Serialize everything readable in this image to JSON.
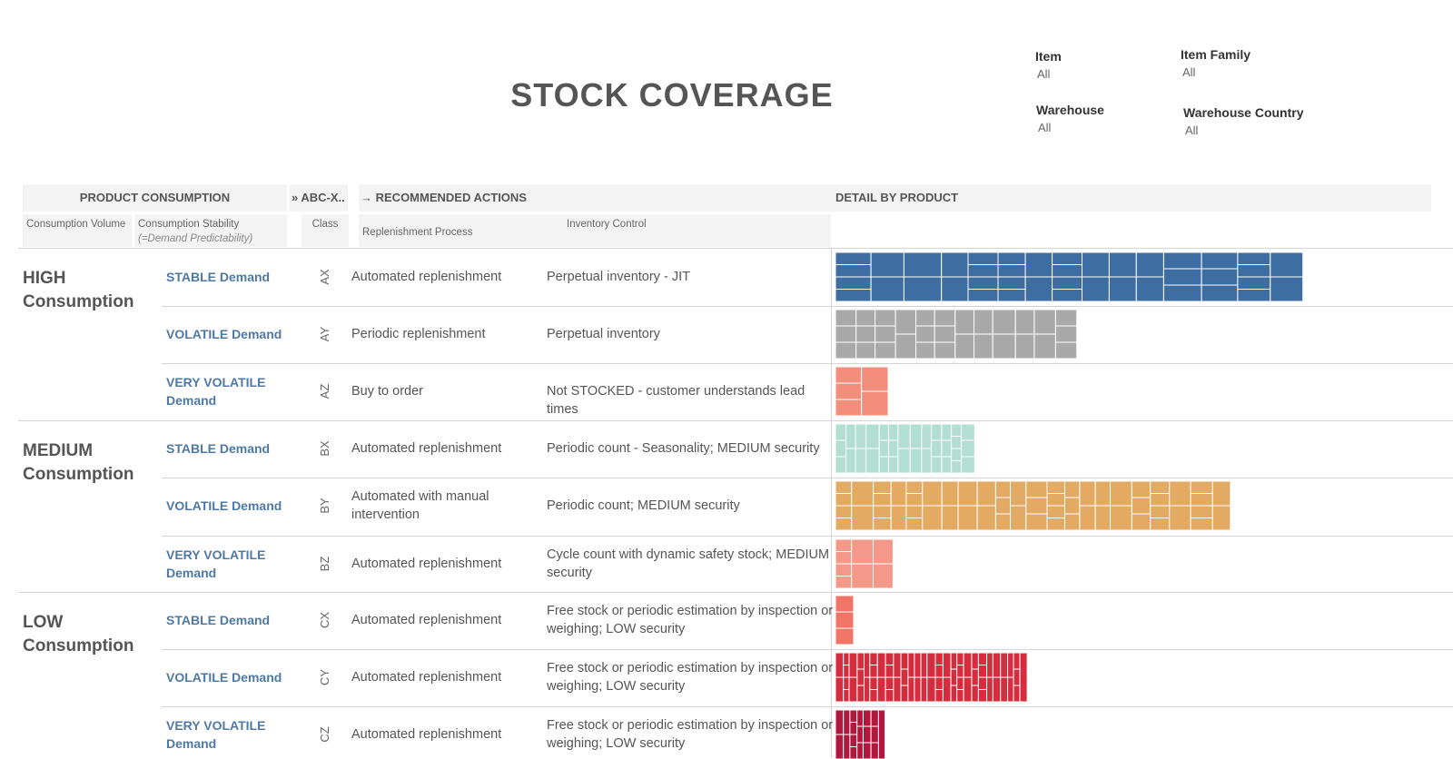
{
  "title": "STOCK COVERAGE",
  "filters": [
    {
      "label": "Item",
      "value": "All"
    },
    {
      "label": "Item Family",
      "value": "All"
    },
    {
      "label": "Warehouse",
      "value": "All"
    },
    {
      "label": "Warehouse Country",
      "value": "All"
    }
  ],
  "headers": {
    "product_consumption": "PRODUCT CONSUMPTION",
    "abc_class": "ABC-X..",
    "recommended_actions": "RECOMMENDED ACTIONS",
    "detail_by_product": "DETAIL BY PRODUCT",
    "consumption_volume": "Consumption Volume",
    "consumption_stability": "Consumption Stability",
    "demand_predictability": "(=Demand Predictability)",
    "class": "Class",
    "replenishment_process": "Replenishment Process",
    "inventory_control": "Inventory Control"
  },
  "groups": [
    {
      "name": "HIGH Consumption"
    },
    {
      "name": "MEDIUM Consumption"
    },
    {
      "name": "LOW Consumption"
    }
  ],
  "rows": [
    {
      "stability": "STABLE Demand",
      "cls": "AX",
      "repl": "Automated replenishment",
      "inv": "Perpetual inventory - JIT",
      "color": "#3e6ea1",
      "cells": 42,
      "share": 1.0
    },
    {
      "stability": "VOLATILE Demand",
      "cls": "AY",
      "repl": "Periodic replenishment",
      "inv": "Perpetual inventory",
      "color": "#a9a9a9",
      "cells": 30,
      "share": 0.45
    },
    {
      "stability": "VERY VOLATILE Demand",
      "cls": "AZ",
      "repl": "Buy to order",
      "inv": "Not STOCKED - customer understands lead times",
      "color": "#f28e7b",
      "cells": 5,
      "share": 0.085
    },
    {
      "stability": "STABLE Demand",
      "cls": "BX",
      "repl": "Automated replenishment",
      "inv": "Periodic count - Seasonality; MEDIUM security",
      "color": "#b2dfd1",
      "cells": 34,
      "share": 0.275
    },
    {
      "stability": "VOLATILE Demand",
      "cls": "BY",
      "repl": "Automated with manual intervention",
      "inv": "Periodic count; MEDIUM security",
      "color": "#e2aa63",
      "cells": 60,
      "share": 0.8
    },
    {
      "stability": "VERY VOLATILE Demand",
      "cls": "BZ",
      "repl": "Automated replenishment",
      "inv": "Cycle count with dynamic safety stock; MEDIUM security",
      "color": "#f4998a",
      "cells": 8,
      "share": 0.125
    },
    {
      "stability": "STABLE Demand",
      "cls": "CX",
      "repl": "Automated replenishment",
      "inv": "Free stock or periodic estimation by inspection or weighing; LOW security",
      "color": "#f07567",
      "cells": 3,
      "share": 0.03
    },
    {
      "stability": "VOLATILE Demand",
      "cls": "CY",
      "repl": "Automated replenishment",
      "inv": "Free stock or periodic estimation by inspection or weighing; LOW security",
      "color": "#d52d3d",
      "cells": 70,
      "share": 0.365
    },
    {
      "stability": "VERY VOLATILE Demand",
      "cls": "CZ",
      "repl": "Automated replenishment",
      "inv": "Free stock or periodic estimation by inspection or weighing; LOW security",
      "color": "#b0183e",
      "cells": 18,
      "share": 0.095
    }
  ]
}
